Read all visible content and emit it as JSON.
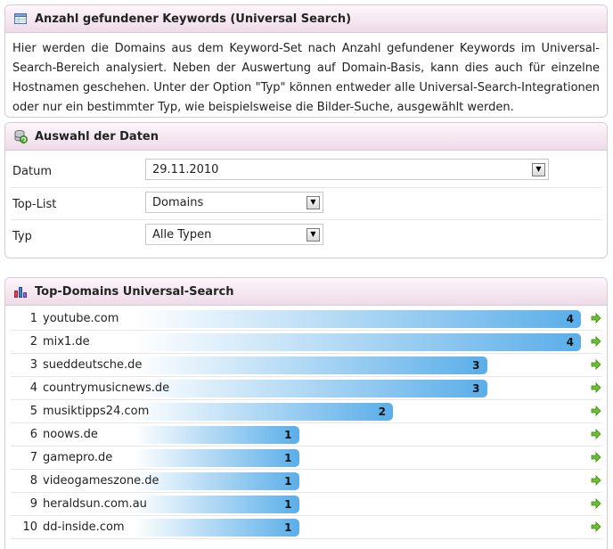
{
  "keywords_panel": {
    "title": "Anzahl gefundener Keywords (Universal Search)",
    "description": "Hier werden die Domains aus dem Keyword-Set nach Anzahl gefundener Keywords im Universal-Search-Bereich analysiert. Neben der Auswertung auf Domain-Basis, kann dies auch für einzelne Hostnamen geschehen. Unter der Option \"Typ\" können entweder alle Universal-Search-Integrationen oder nur ein bestimmter Typ, wie beispielsweise die Bilder-Suche, ausgewählt werden."
  },
  "data_selection": {
    "title": "Auswahl der Daten",
    "datum": {
      "label": "Datum",
      "value": "29.11.2010"
    },
    "toplist": {
      "label": "Top-List",
      "value": "Domains"
    },
    "typ": {
      "label": "Typ",
      "value": "Alle Typen"
    }
  },
  "top_domains": {
    "title": "Top-Domains Universal-Search",
    "max_value": 4,
    "rows": [
      {
        "rank": "1",
        "domain": "youtube.com",
        "count": 4
      },
      {
        "rank": "2",
        "domain": "mix1.de",
        "count": 4
      },
      {
        "rank": "3",
        "domain": "sueddeutsche.de",
        "count": 3
      },
      {
        "rank": "4",
        "domain": "countrymusicnews.de",
        "count": 3
      },
      {
        "rank": "5",
        "domain": "musiktipps24.com",
        "count": 2
      },
      {
        "rank": "6",
        "domain": "noows.de",
        "count": 1
      },
      {
        "rank": "7",
        "domain": "gamepro.de",
        "count": 1
      },
      {
        "rank": "8",
        "domain": "videogameszone.de",
        "count": 1
      },
      {
        "rank": "9",
        "domain": "heraldsun.com.au",
        "count": 1
      },
      {
        "rank": "10",
        "domain": "dd-inside.com",
        "count": 1
      }
    ]
  },
  "colors": {
    "header_bg": "#eedbe8",
    "bar": "#5aaee9",
    "arrow": "#6cbf2e"
  }
}
